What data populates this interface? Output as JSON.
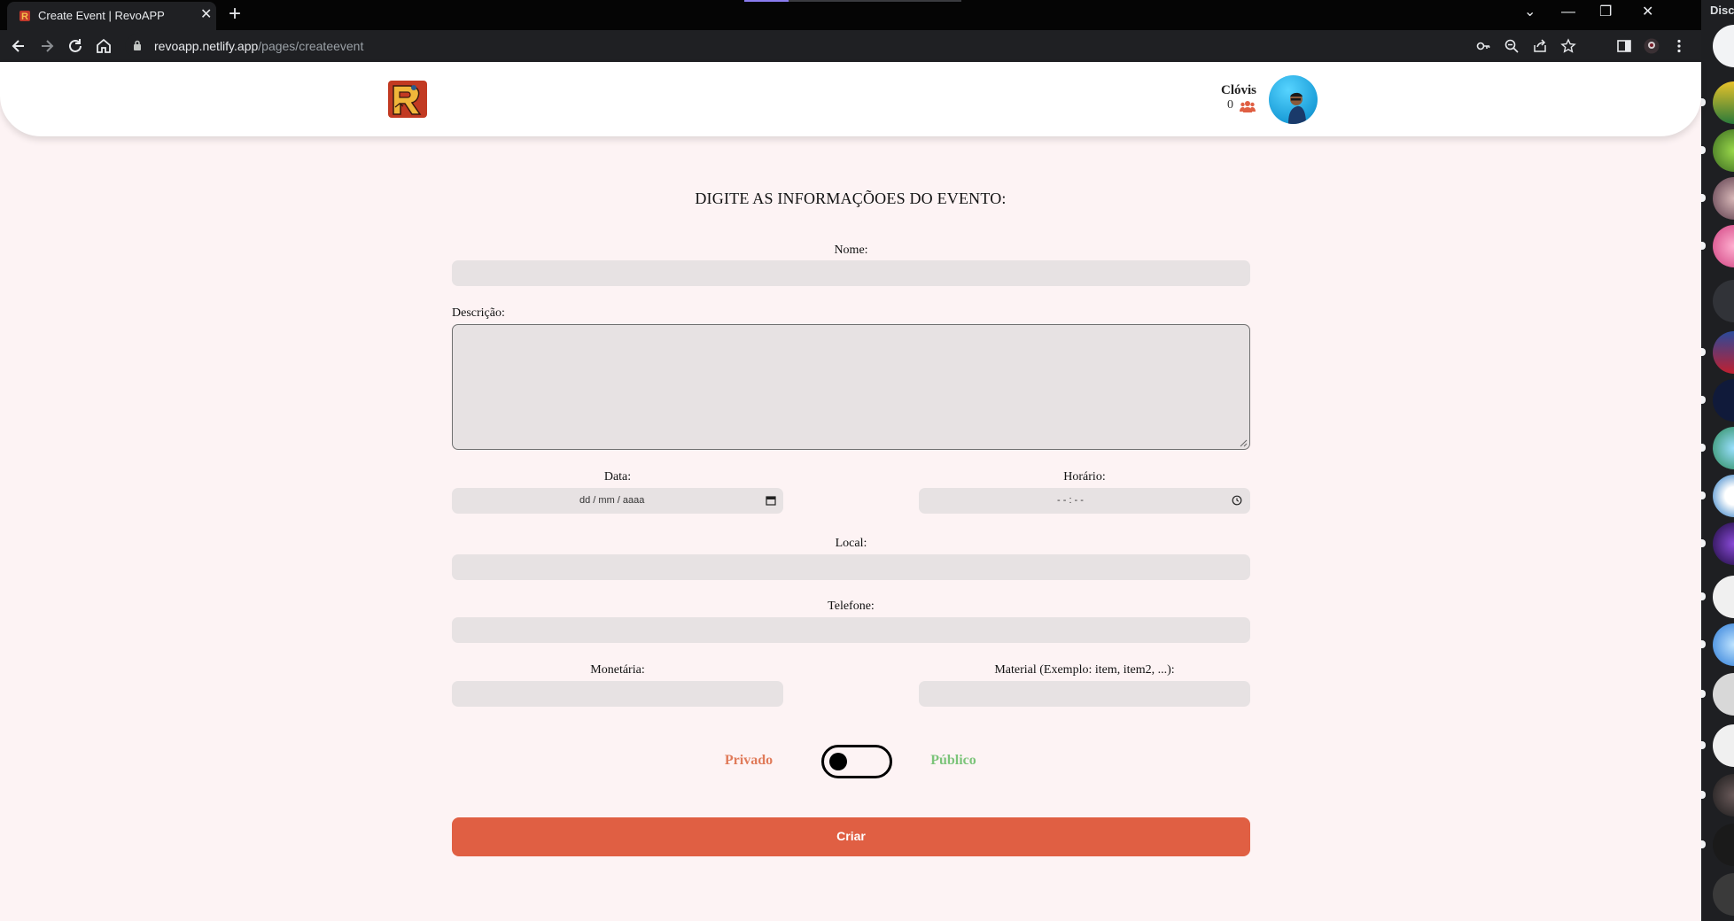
{
  "browser": {
    "tab_title": "Create Event | RevoAPP",
    "tab_close": "✕",
    "new_tab": "+",
    "url_host": "revoapp.netlify.app",
    "url_path": "/pages/createevent",
    "window_controls": {
      "minimize": "—",
      "restore": "❐",
      "close": "✕",
      "tab_search": "⌄"
    }
  },
  "side_app": {
    "label": "Disco"
  },
  "header": {
    "user_name": "Clóvis",
    "user_count": "0"
  },
  "form": {
    "title": "DIGITE AS INFORMAÇÕOES DO EVENTO:",
    "nome_label": "Nome:",
    "descricao_label": "Descrição:",
    "data_label": "Data:",
    "data_placeholder": "dd / mm / aaaa",
    "horario_label": "Horário:",
    "horario_placeholder": "- - : - -",
    "local_label": "Local:",
    "telefone_label": "Telefone:",
    "monetaria_label": "Monetária:",
    "material_label": "Material (Exemplo: item, item2, ...):",
    "privado_label": "Privado",
    "publico_label": "Público",
    "toggle_public": false,
    "submit_label": "Criar"
  },
  "colors": {
    "accent": "#e05f43",
    "privado": "#e07b5a",
    "publico": "#7cc47a",
    "page_bg": "#fdf3f4",
    "input_bg": "#e7e2e3"
  }
}
